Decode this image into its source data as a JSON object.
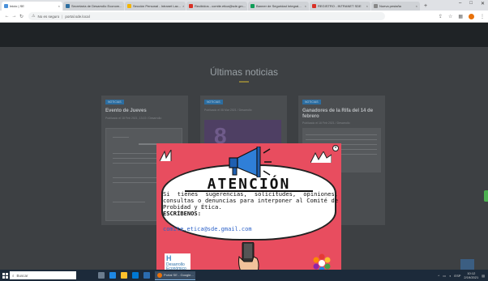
{
  "browser": {
    "tabs": [
      {
        "label": "Inicio | SE",
        "active": true
      },
      {
        "label": "Secretaría de Desarrollo Econom...",
        "active": false
      },
      {
        "label": "Sección Personal - Intranet Lac...",
        "active": false
      },
      {
        "label": "Recibidos - comite.etica@sde.gm...",
        "active": false
      },
      {
        "label": "Banner de Seguridad Integral...",
        "active": false
      },
      {
        "label": "REGISTRO - INTRANET SDE",
        "active": false
      },
      {
        "label": "Nueva pestaña",
        "active": false
      }
    ],
    "new_tab": "+",
    "url_warning": "No es seguro",
    "url": "portal.sde.local",
    "window_controls": [
      "–",
      "□",
      "✕"
    ]
  },
  "page": {
    "hero_text": "",
    "section_title": "Últimas noticias",
    "cards": [
      {
        "tag": "NOTICIAS",
        "title": "Evento de Jueves",
        "meta": "Publicado el 18 Feb 2021, 13:22 / Desarrollo"
      },
      {
        "tag": "NOTICIAS",
        "title": "",
        "meta": "Publicado el 08 Mar 2021 / Desarrollo"
      },
      {
        "tag": "NOTICIAS",
        "title": "Ganadores de la Rifa del 14 de febrero",
        "meta": "Publicado el 16 Feb 2021 / Desarrollo"
      }
    ],
    "card2_number": "8"
  },
  "modal": {
    "close": "×",
    "heading": "ATENCIÓN",
    "message": "Si tienes sugerencias, solicitudes, opiniones, consultas o denuncias para interponer al Comité de Probidad y Ética.",
    "cta": "ESCRÍBENOS:",
    "email": "comite.etica@sde.gmail.com",
    "logo_letter": "H",
    "logo_text": "Desarrollo Económico"
  },
  "taskbar": {
    "search_placeholder": "Buscar",
    "active_window": "Portal SE - Google...",
    "tray_lang": "ESP",
    "time": "10:12",
    "date": "2/19/2021"
  },
  "colors": {
    "modal_bg": "#e84d5f",
    "email": "#2e63c9",
    "taskbar": "#1c2a3a"
  }
}
